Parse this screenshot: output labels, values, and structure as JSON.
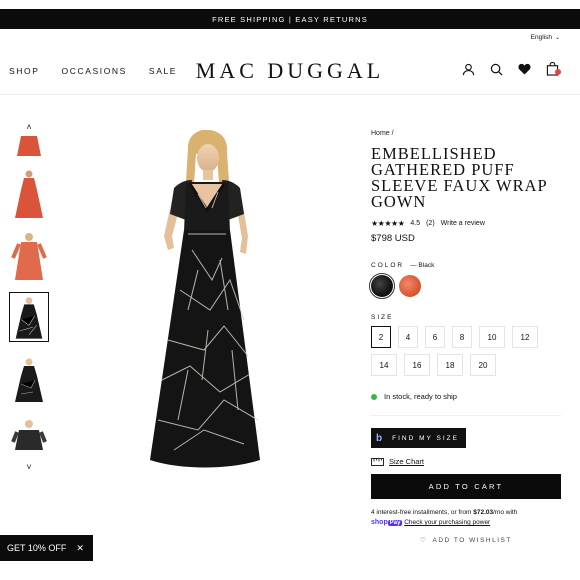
{
  "promo": {
    "text": "FREE SHIPPING | EASY RETURNS"
  },
  "language": {
    "label": "English"
  },
  "nav": {
    "items": [
      "SHOP",
      "OCCASIONS",
      "SALE"
    ]
  },
  "brand": {
    "logo": "MAC DUGGAL"
  },
  "header_icons": [
    "account-icon",
    "search-icon",
    "heart-icon",
    "cart-icon"
  ],
  "product": {
    "breadcrumb": "Home /",
    "title": "EMBELLISHED GATHERED PUFF SLEEVE FAUX WRAP GOWN",
    "stars": "★★★★★",
    "rating": "4.5",
    "review_count": "(2)",
    "write_review": "Write a review",
    "price": "$798 USD",
    "color_label": "COLOR",
    "color_selected": "— Black",
    "size_label": "SIZE",
    "sizes": [
      "2",
      "4",
      "6",
      "8",
      "10",
      "12",
      "14",
      "16",
      "18",
      "20"
    ],
    "selected_size": "2",
    "stock": "In stock, ready to ship",
    "find_my_size": "FIND MY SIZE",
    "size_chart": "Size Chart",
    "add_to_cart": "ADD TO CART",
    "installments_pre": "4 interest-free installments, or from ",
    "installments_amount": "$72.03",
    "installments_post": "/mo with",
    "shop_pay_shop": "shop",
    "shop_pay_pay": "Pay",
    "check_power": "Check your purchasing power",
    "wishlist": "ADD TO WISHLIST"
  },
  "popup": {
    "label": "GET 10% OFF"
  },
  "colors": {
    "accent_black": "#0b0b0b",
    "in_stock": "#3bb54a",
    "cart_badge": "#e0463b",
    "coral_swatch": "#d7502e"
  }
}
